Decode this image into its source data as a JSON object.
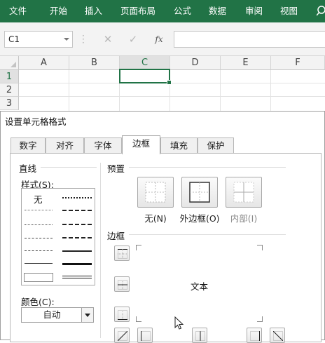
{
  "ribbon": {
    "tabs": [
      "文件",
      "开始",
      "插入",
      "页面布局",
      "公式",
      "数据",
      "审阅",
      "视图"
    ],
    "accent": "#217346"
  },
  "formula_bar": {
    "name_box": "C1",
    "formula": ""
  },
  "sheet": {
    "columns": [
      "A",
      "B",
      "C",
      "D",
      "E",
      "F"
    ],
    "rows": [
      "1",
      "2",
      "3"
    ],
    "selected_cell": "C1"
  },
  "dialog": {
    "title": "设置单元格格式",
    "tabs": [
      "数字",
      "对齐",
      "字体",
      "边框",
      "填充",
      "保护"
    ],
    "active_tab": "边框",
    "line_section": {
      "heading": "直线",
      "style_label": "样式(S):",
      "none_label": "无",
      "color_label": "颜色(C):",
      "color_value": "自动"
    },
    "presets_section": {
      "heading": "预置",
      "none": "无(N)",
      "outline": "外边框(O)",
      "inside": "内部(I)"
    },
    "border_section": {
      "heading": "边框",
      "preview_text": "文本"
    }
  }
}
